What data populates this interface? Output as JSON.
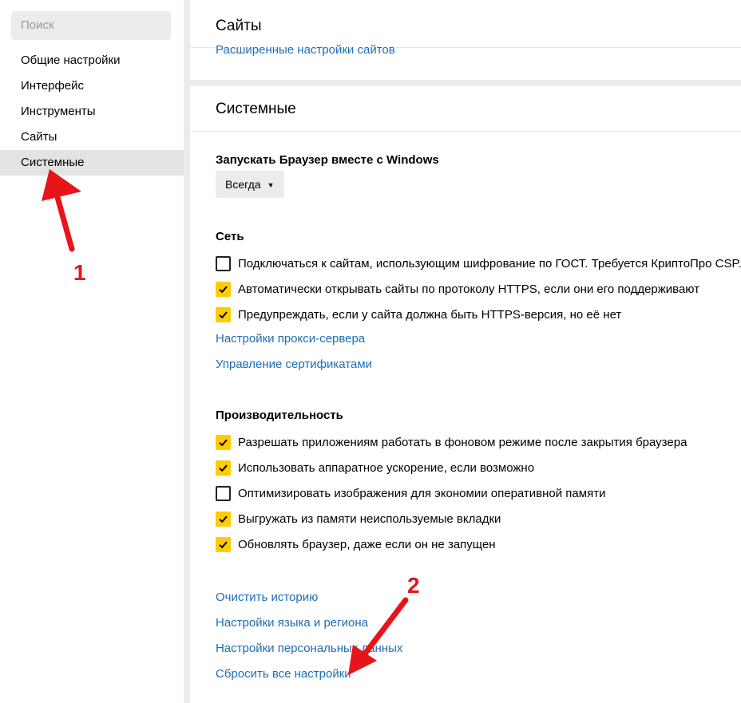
{
  "sidebar": {
    "search_placeholder": "Поиск",
    "items": [
      {
        "label": "Общие настройки"
      },
      {
        "label": "Интерфейс"
      },
      {
        "label": "Инструменты"
      },
      {
        "label": "Сайты"
      },
      {
        "label": "Системные",
        "active": true
      }
    ]
  },
  "sites_panel": {
    "title": "Сайты",
    "advanced_link": "Расширенные настройки сайтов"
  },
  "system_panel": {
    "title": "Системные",
    "startup": {
      "label": "Запускать Браузер вместе с Windows",
      "value": "Всегда"
    },
    "network": {
      "heading": "Сеть",
      "options": [
        {
          "label": "Подключаться к сайтам, использующим шифрование по ГОСТ. Требуется КриптоПро CSP.",
          "checked": false
        },
        {
          "label": "Автоматически открывать сайты по протоколу HTTPS, если они его поддерживают",
          "checked": true
        },
        {
          "label": "Предупреждать, если у сайта должна быть HTTPS-версия, но её нет",
          "checked": true
        }
      ],
      "proxy_link": "Настройки прокси-сервера",
      "certs_link": "Управление сертификатами"
    },
    "performance": {
      "heading": "Производительность",
      "options": [
        {
          "label": "Разрешать приложениям работать в фоновом режиме после закрытия браузера",
          "checked": true
        },
        {
          "label": "Использовать аппаратное ускорение, если возможно",
          "checked": true
        },
        {
          "label": "Оптимизировать изображения для экономии оперативной памяти",
          "checked": false
        },
        {
          "label": "Выгружать из памяти неиспользуемые вкладки",
          "checked": true
        },
        {
          "label": "Обновлять браузер, даже если он не запущен",
          "checked": true
        }
      ]
    },
    "links": {
      "clear_history": "Очистить историю",
      "language": "Настройки языка и региона",
      "personal_data": "Настройки персональных данных",
      "reset": "Сбросить все настройки"
    }
  },
  "annotations": {
    "marker_1": "1",
    "marker_2": "2",
    "color": "#e8141b"
  },
  "colors": {
    "accent_checkbox": "#ffcc00",
    "link": "#1d6db6",
    "background": "#ebebeb"
  }
}
